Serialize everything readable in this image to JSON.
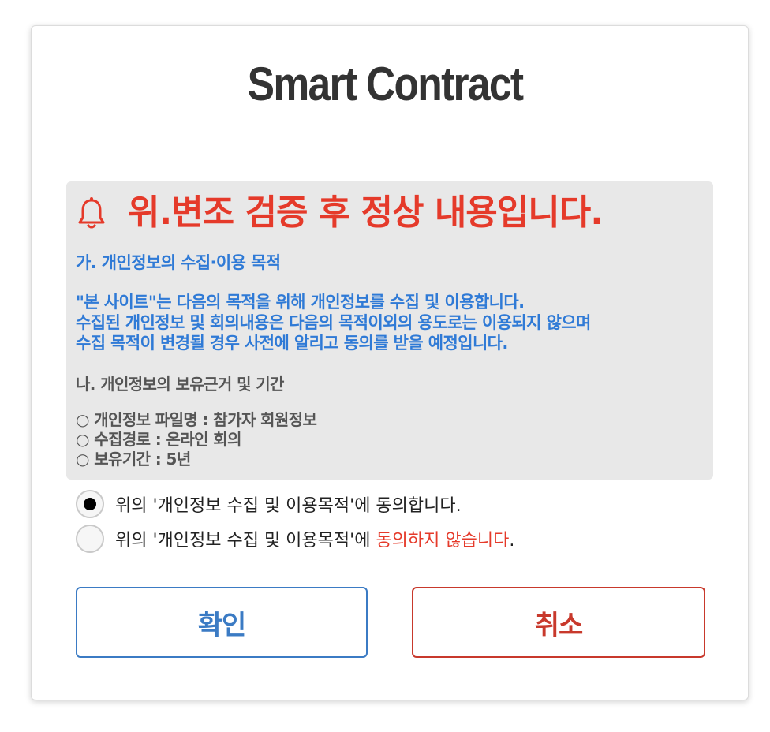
{
  "app": {
    "title": "Smart Contract"
  },
  "notice": {
    "headline": "위.변조 검증 후 정상 내용입니다.",
    "icon": "bell-icon",
    "section_a_title": "가. 개인정보의 수집·이용 목적",
    "section_a_lines": [
      "\"본 사이트\"는 다음의 목적을 위해 개인정보를 수집 및 이용합니다.",
      "수집된 개인정보 및 회의내용은 다음의 목적이외의 용도로는 이용되지 않으며",
      "수집 목적이 변경될 경우 사전에 알리고 동의를 받을 예정입니다."
    ],
    "section_b_title": "나. 개인정보의 보유근거 및 기간",
    "section_b_items": [
      "○ 개인정보 파일명 : 참가자 회원정보",
      "○ 수집경로 : 온라인 회의",
      "○ 보유기간 : 5년"
    ]
  },
  "consent": {
    "agree_label": "위의 '개인정보 수집 및 이용목적'에 동의합니다.",
    "disagree_prefix": "위의 '개인정보 수집 및 이용목적'에 ",
    "disagree_emphasis": "동의하지 않습니다",
    "disagree_suffix": ".",
    "selected": "agree"
  },
  "buttons": {
    "confirm_label": "확인",
    "cancel_label": "취소"
  },
  "colors": {
    "headline_red": "#e53a2a",
    "info_blue": "#2f7ad6",
    "confirm_blue": "#3b7bc4",
    "cancel_red": "#c8392c"
  }
}
